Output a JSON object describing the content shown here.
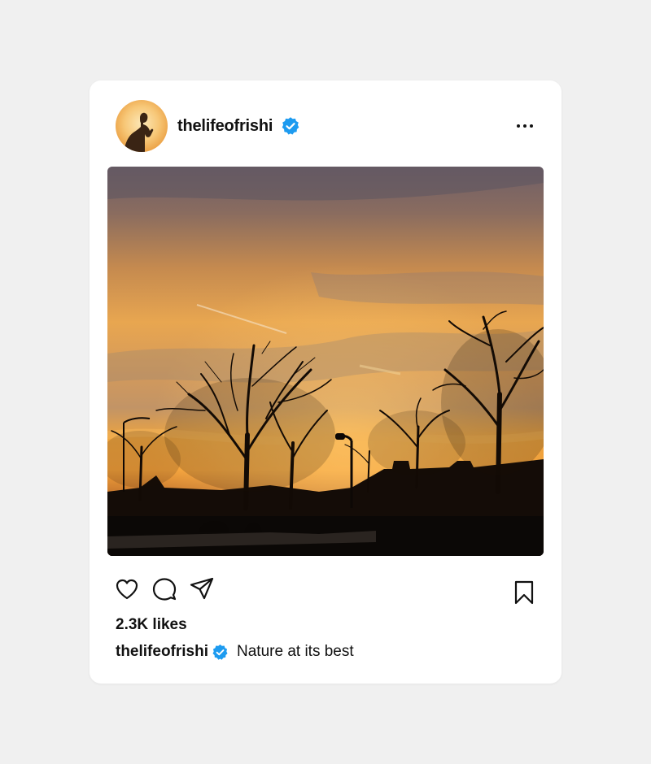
{
  "post": {
    "username": "thelifeofrishi",
    "likes": "2.3K likes",
    "caption_user": "thelifeofrishi",
    "caption_text": "Nature at its best"
  },
  "icons": {
    "avatar": "user-avatar",
    "verified": "verified-badge-icon",
    "more": "more-options-icon",
    "like": "heart-icon",
    "comment": "comment-icon",
    "share": "send-icon",
    "save": "bookmark-icon"
  },
  "colors": {
    "verified": "#1d9bf0",
    "background": "#f0f0f0",
    "card": "#ffffff"
  }
}
